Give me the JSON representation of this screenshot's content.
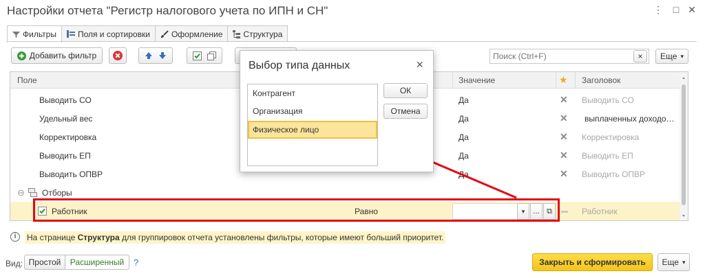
{
  "window": {
    "title": "Настройки отчета \"Регистр налогового учета по ИПН и СН\"",
    "controls": [
      "⋮",
      "□",
      "✕"
    ]
  },
  "tabs": [
    {
      "label": "Фильтры",
      "icon": "funnel-icon"
    },
    {
      "label": "Поля и сортировки",
      "icon": "columns-icon"
    },
    {
      "label": "Оформление",
      "icon": "brush-icon"
    },
    {
      "label": "Структура",
      "icon": "tree-icon"
    }
  ],
  "toolbar": {
    "add_filter_label": "Добавить фильтр",
    "search_placeholder": "Поиск (Ctrl+F)",
    "search_clear": "×",
    "more_label": "Еще",
    "more_arrow": "▾"
  },
  "grid": {
    "headers": {
      "field": "Поле",
      "value": "Значение",
      "title": "Заголовок"
    },
    "rows": [
      {
        "field": "Выводить СО",
        "value": "Да",
        "title": "Выводить СО",
        "title_muted": true
      },
      {
        "field": "Удельный вес",
        "value": "Да",
        "title": "выплаченных доходо…",
        "title_muted": false
      },
      {
        "field": "Корректировка",
        "value": "Да",
        "title": "Корректировка",
        "title_muted": true
      },
      {
        "field": "Выводить ЕП",
        "value": "Да",
        "title": "Выводить ЕП",
        "title_muted": true
      },
      {
        "field": "Выводить ОПВР",
        "value": "Да",
        "title": "Выводить ОПВР",
        "title_muted": true
      }
    ],
    "group": {
      "label": "Отборы",
      "expander": "⊖"
    },
    "selected_row": {
      "field": "Работник",
      "checked": true,
      "condition": "Равно",
      "value": "",
      "dropdown": "▾",
      "ellipsis": "...",
      "open_icon": "⧉",
      "title": "Работник"
    }
  },
  "dialog": {
    "title": "Выбор типа данных",
    "close": "×",
    "options": [
      "Контрагент",
      "Организация",
      "Физическое лицо"
    ],
    "selected_index": 2,
    "ok_label": "ОК",
    "cancel_label": "Отмена"
  },
  "info": {
    "icon": "i",
    "text_before": "На странице ",
    "text_bold": "Структура",
    "text_after": " для группировок отчета установлены фильтры, которые имеют больший приоритет."
  },
  "footer": {
    "view_label": "Вид:",
    "mode_simple": "Простой",
    "mode_advanced": "Расширенный",
    "help": "?",
    "close_build_label": "Закрыть и сформировать",
    "more_label": "Еще",
    "more_arrow": "▾"
  },
  "colors": {
    "highlight_row": "#fdf3c9",
    "annotation_red": "#e30613",
    "primary_button": "#fbd52a",
    "dialog_selection": "#fbe59b",
    "tick_green": "#2c9a3a"
  }
}
